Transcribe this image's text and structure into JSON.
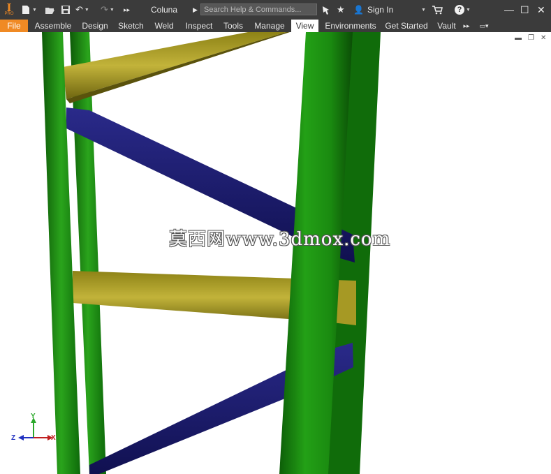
{
  "app": {
    "logo_letter": "I",
    "logo_edition": "PRO"
  },
  "title_bar": {
    "document_title": "Coluna",
    "search_placeholder": "Search Help & Commands...",
    "sign_in_label": "Sign In"
  },
  "ribbon_tabs": [
    {
      "label": "File"
    },
    {
      "label": "Assemble"
    },
    {
      "label": "Design"
    },
    {
      "label": "Sketch"
    },
    {
      "label": "Weld"
    },
    {
      "label": "Inspect"
    },
    {
      "label": "Tools"
    },
    {
      "label": "Manage"
    },
    {
      "label": "View"
    },
    {
      "label": "Environments"
    },
    {
      "label": "Get Started"
    },
    {
      "label": "Vault"
    }
  ],
  "active_tab": "View",
  "viewport": {
    "watermark": "莫西网www.3dmox.com",
    "triad": {
      "x": "X",
      "y": "Y",
      "z": "Z"
    }
  },
  "colors": {
    "chrome": "#3b3b3b",
    "accent": "#f08a24",
    "column_green": "#1c8a14",
    "beam_yellow": "#b4a525",
    "brace_blue": "#1c1c70"
  }
}
